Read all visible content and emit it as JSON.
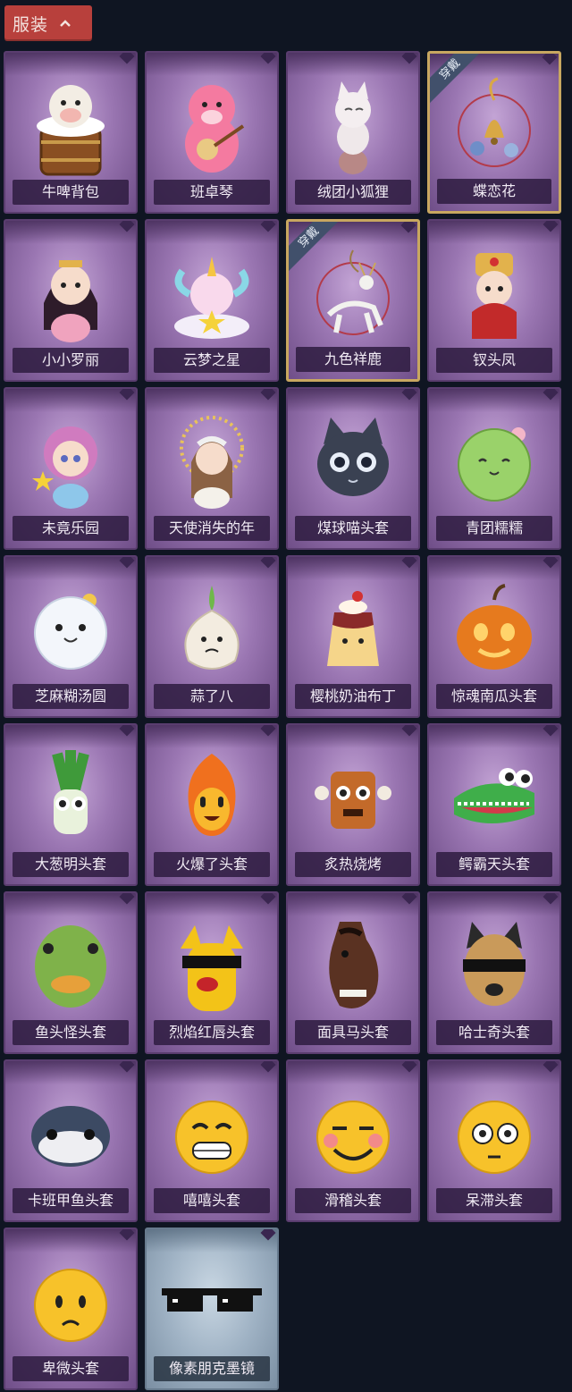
{
  "section": {
    "title": "服装",
    "collapse_icon": "chevron-up-icon"
  },
  "worn_badge": "穿戴",
  "items": [
    {
      "label": "牛啤背包",
      "art": "cow-beer-barrel",
      "worn": false
    },
    {
      "label": "班卓琴",
      "art": "pink-beaver-banjo",
      "worn": false
    },
    {
      "label": "绒团小狐狸",
      "art": "white-fox",
      "worn": false
    },
    {
      "label": "蝶恋花",
      "art": "bell-flower-ornament",
      "worn": true
    },
    {
      "label": "小小罗丽",
      "art": "princess-doll",
      "worn": false
    },
    {
      "label": "云梦之星",
      "art": "unicorn-cloud",
      "worn": false
    },
    {
      "label": "九色祥鹿",
      "art": "white-deer",
      "worn": true
    },
    {
      "label": "钗头凤",
      "art": "phoenix-crown-doll",
      "worn": false
    },
    {
      "label": "未竟乐园",
      "art": "magical-girl",
      "worn": false
    },
    {
      "label": "天使消失的年",
      "art": "angel-girl",
      "worn": false
    },
    {
      "label": "煤球喵头套",
      "art": "black-cat-head",
      "worn": false
    },
    {
      "label": "青团糯糯",
      "art": "green-rice-ball",
      "worn": false
    },
    {
      "label": "芝麻糊汤圆",
      "art": "white-dumpling",
      "worn": false
    },
    {
      "label": "蒜了八",
      "art": "garlic",
      "worn": false
    },
    {
      "label": "樱桃奶油布丁",
      "art": "pudding",
      "worn": false
    },
    {
      "label": "惊魂南瓜头套",
      "art": "pumpkin",
      "worn": false
    },
    {
      "label": "大葱明头套",
      "art": "green-onion",
      "worn": false
    },
    {
      "label": "火爆了头套",
      "art": "fire-spirit",
      "worn": false
    },
    {
      "label": "炙热烧烤",
      "art": "bbq-meat",
      "worn": false
    },
    {
      "label": "鳄霸天头套",
      "art": "crocodile",
      "worn": false
    },
    {
      "label": "鱼头怪头套",
      "art": "fish-head",
      "worn": false
    },
    {
      "label": "烈焰红唇头套",
      "art": "yellow-mouse-lips",
      "worn": false
    },
    {
      "label": "面具马头套",
      "art": "horse-head",
      "worn": false
    },
    {
      "label": "哈士奇头套",
      "art": "husky-sunglasses",
      "worn": false
    },
    {
      "label": "卡班甲鱼头套",
      "art": "turtle-head",
      "worn": false
    },
    {
      "label": "嘻嘻头套",
      "art": "grin-emoji",
      "worn": false
    },
    {
      "label": "滑稽头套",
      "art": "smirk-emoji",
      "worn": false
    },
    {
      "label": "呆滞头套",
      "art": "dazed-emoji",
      "worn": false
    },
    {
      "label": "卑微头套",
      "art": "humble-emoji",
      "worn": false
    },
    {
      "label": "像素朋克墨镜",
      "art": "pixel-sunglasses",
      "worn": false,
      "plain": true
    }
  ]
}
